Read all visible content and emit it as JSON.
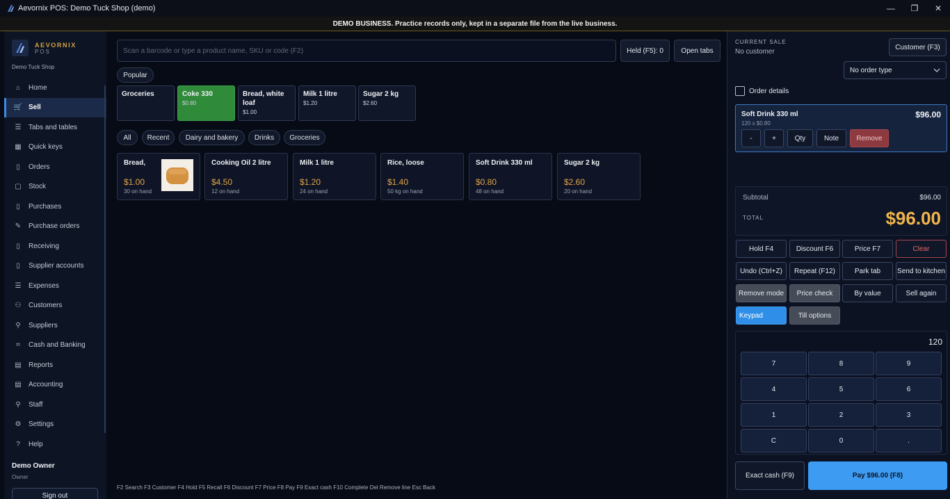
{
  "window": {
    "title": "Aevornix POS: Demo Tuck Shop (demo)",
    "minimize": "—",
    "maximize": "❐",
    "close": "✕"
  },
  "banner": "DEMO BUSINESS. Practice records only, kept in a separate file from the live business.",
  "sidebar": {
    "brand_line1": "AEVORNIX",
    "brand_line2": "POS",
    "shop_name": "Demo Tuck Shop",
    "items": [
      {
        "label": "Home",
        "icon": "home-icon",
        "glyph": "⌂"
      },
      {
        "label": "Sell",
        "icon": "cart-icon",
        "glyph": "🛒"
      },
      {
        "label": "Tabs and tables",
        "icon": "list-icon",
        "glyph": "☰"
      },
      {
        "label": "Quick keys",
        "icon": "grid-icon",
        "glyph": "▦"
      },
      {
        "label": "Orders",
        "icon": "document-icon",
        "glyph": "▯"
      },
      {
        "label": "Stock",
        "icon": "box-icon",
        "glyph": "▢"
      },
      {
        "label": "Purchases",
        "icon": "document-icon",
        "glyph": "▯"
      },
      {
        "label": "Purchase orders",
        "icon": "edit-icon",
        "glyph": "✎"
      },
      {
        "label": "Receiving",
        "icon": "document-icon",
        "glyph": "▯"
      },
      {
        "label": "Supplier accounts",
        "icon": "document-icon",
        "glyph": "▯"
      },
      {
        "label": "Expenses",
        "icon": "list-icon",
        "glyph": "☰"
      },
      {
        "label": "Customers",
        "icon": "people-icon",
        "glyph": "⚇"
      },
      {
        "label": "Suppliers",
        "icon": "person-icon",
        "glyph": "⚲"
      },
      {
        "label": "Cash and Banking",
        "icon": "bank-icon",
        "glyph": "⌗"
      },
      {
        "label": "Reports",
        "icon": "report-icon",
        "glyph": "▤"
      },
      {
        "label": "Accounting",
        "icon": "ledger-icon",
        "glyph": "▤"
      },
      {
        "label": "Staff",
        "icon": "person-icon",
        "glyph": "⚲"
      },
      {
        "label": "Settings",
        "icon": "gear-icon",
        "glyph": "⚙"
      },
      {
        "label": "Help",
        "icon": "help-icon",
        "glyph": "?"
      }
    ],
    "active_item": "Sell",
    "user_name": "Demo Owner",
    "user_role": "Owner",
    "sign_out": "Sign out"
  },
  "search": {
    "placeholder": "Scan a barcode or type a product name, SKU or code (F2)"
  },
  "held_button": "Held (F5): 0",
  "open_tabs_button": "Open tabs",
  "popular_chip": "Popular",
  "quick_keys": [
    {
      "name": "Groceries",
      "price": ""
    },
    {
      "name": "Coke 330",
      "price": "$0.80",
      "highlight": true
    },
    {
      "name": "Bread, white loaf",
      "price": "$1.00"
    },
    {
      "name": "Milk 1 litre",
      "price": "$1.20"
    },
    {
      "name": "Sugar 2 kg",
      "price": "$2.60"
    }
  ],
  "category_filters": [
    "All",
    "Recent",
    "Dairy and bakery",
    "Drinks",
    "Groceries"
  ],
  "products": [
    {
      "name": "Bread,",
      "price": "$1.00",
      "stock": "30 on hand",
      "has_image": true
    },
    {
      "name": "Cooking Oil 2 litre",
      "price": "$4.50",
      "stock": "12 on hand"
    },
    {
      "name": "Milk 1 litre",
      "price": "$1.20",
      "stock": "24 on hand"
    },
    {
      "name": "Rice, loose",
      "price": "$1.40",
      "stock": "50 kg on hand"
    },
    {
      "name": "Soft Drink 330 ml",
      "price": "$0.80",
      "stock": "48 on hand"
    },
    {
      "name": "Sugar 2 kg",
      "price": "$2.60",
      "stock": "20 on hand"
    }
  ],
  "shortcuts": "F2 Search   F3 Customer   F4 Hold   F5 Recall   F6 Discount   F7 Price   F8 Pay   F9 Exact cash   F10 Complete   Del Remove line   Esc Back",
  "sale": {
    "header": "CURRENT SALE",
    "customer_status": "No customer",
    "customer_button": "Customer (F3)",
    "order_type": "No order type",
    "order_details_label": "Order details",
    "line": {
      "name": "Soft Drink 330 ml",
      "detail": "120 x $0.80",
      "total": "$96.00",
      "buttons": {
        "minus": "-",
        "plus": "+",
        "qty": "Qty",
        "note": "Note",
        "remove": "Remove"
      }
    },
    "subtotal_label": "Subtotal",
    "subtotal_value": "$96.00",
    "total_label": "TOTAL",
    "total_value": "$96.00"
  },
  "actions": {
    "row1": [
      "Hold   F4",
      "Discount   F6",
      "Price   F7",
      "Clear"
    ],
    "row2": [
      "Undo (Ctrl+Z)",
      "Repeat (F12)",
      "Park tab",
      "Send to kitchen"
    ],
    "row3": [
      "Remove mode",
      "Price check",
      "By value",
      "Sell again"
    ],
    "row4": [
      "Keypad",
      "Till options"
    ]
  },
  "keypad": {
    "display": "120",
    "keys": [
      "7",
      "8",
      "9",
      "4",
      "5",
      "6",
      "1",
      "2",
      "3",
      "C",
      "0",
      "."
    ]
  },
  "exact_cash": "Exact cash (F9)",
  "pay": "Pay   $96.00   (F8)",
  "colors": {
    "accent": "#3d9bf2",
    "total": "#f2b54a",
    "price": "#e1a548",
    "quick_highlight": "#2f8a3a",
    "danger": "#ea6a6a"
  }
}
